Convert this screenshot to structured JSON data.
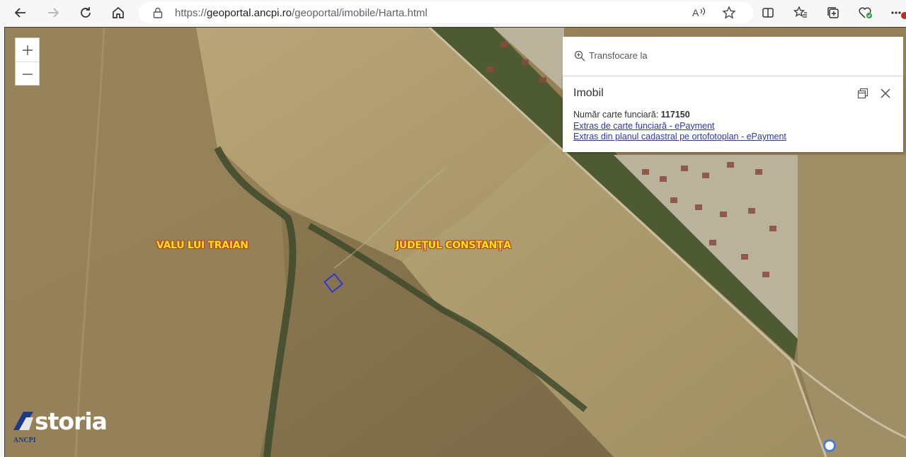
{
  "browser": {
    "url_scheme": "https://",
    "url_host": "geoportal.ancpi.ro",
    "url_path": "/geoportal/imobile/Harta.html",
    "icons": [
      "back-icon",
      "forward-icon",
      "refresh-icon",
      "home-icon",
      "lock-icon",
      "read-aloud-icon",
      "favorite-star-icon",
      "split-screen-icon",
      "favorites-icon",
      "collections-icon",
      "browser-essentials-icon",
      "more-icon"
    ]
  },
  "map": {
    "zoom_in_label": "+",
    "zoom_out_label": "−",
    "labels": {
      "valu": "VALU LUI TRAIAN",
      "judet": "JUDEŢUL CONSTANŢA"
    },
    "parcel_color": "#2f37d6"
  },
  "search": {
    "placeholder": "Transfocare la"
  },
  "popup": {
    "title": "Imobil",
    "field_label": "Număr carte funciară:",
    "field_value": "117150",
    "link1": "Extras de carte funciară - ePayment",
    "link2": "Extras din planul cadastral pe ortofotoplan - ePayment"
  },
  "watermark": {
    "brand": "storia",
    "agency": "ANCPI"
  },
  "colors": {
    "label_text": "#ffe800",
    "label_outline": "#c0392b",
    "link": "#2b3aa5",
    "location_dot": "#4a7dd4"
  }
}
